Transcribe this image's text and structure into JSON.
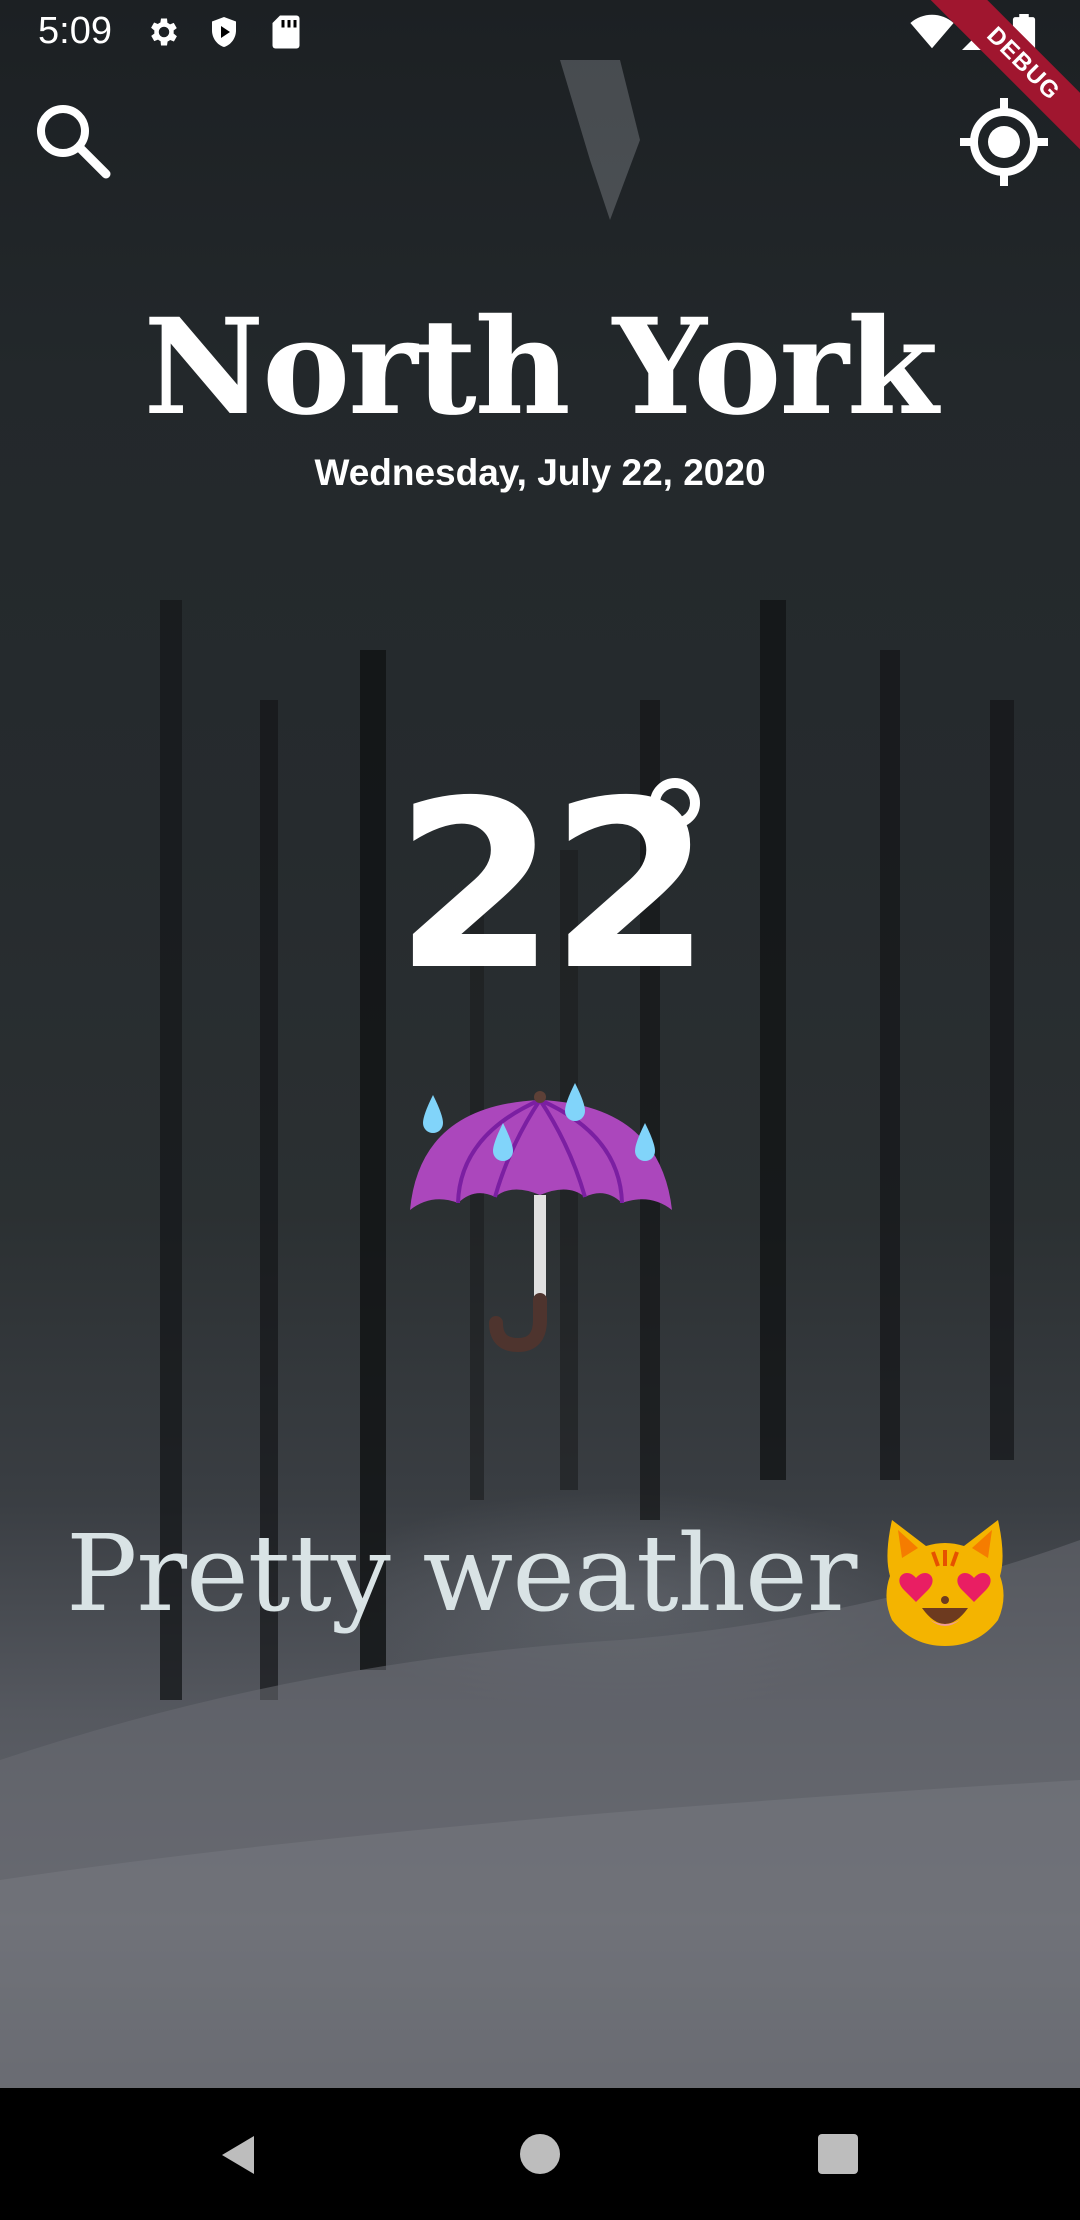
{
  "status_bar": {
    "time": "5:09",
    "left_icons": [
      "gear-icon",
      "shield-play-icon",
      "sd-card-icon"
    ],
    "right_icons": [
      "wifi-icon",
      "cell-signal-icon",
      "battery-icon"
    ]
  },
  "toolbar": {
    "search_icon": "search-icon",
    "location_icon": "crosshair-location-icon"
  },
  "debug_banner": "DEBUG",
  "weather": {
    "city": "North York",
    "date": "Wednesday, July 22, 2020",
    "temperature": "22",
    "condition_icon": "umbrella-with-rain-emoji",
    "message": "Pretty weather",
    "message_emoji": "smiling-cat-heart-eyes-emoji"
  },
  "nav_bar": {
    "icons": [
      "back-icon",
      "home-icon",
      "recents-icon"
    ]
  }
}
